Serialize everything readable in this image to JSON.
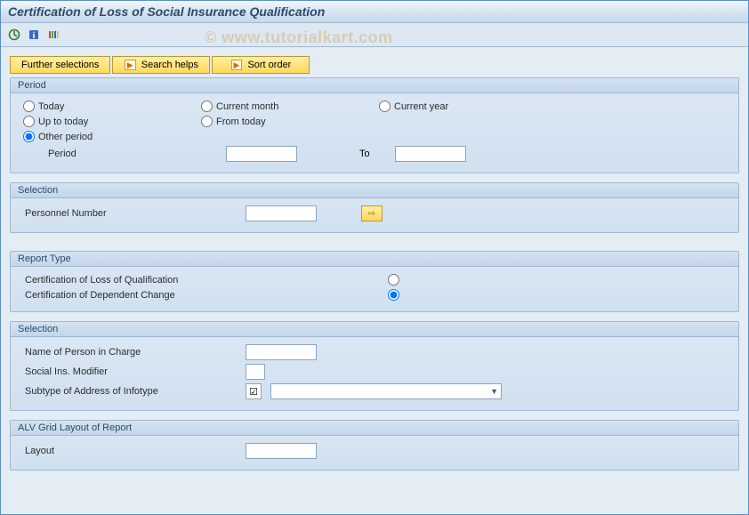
{
  "title": "Certification of Loss of Social Insurance Qualification",
  "watermark": "© www.tutorialkart.com",
  "toolbar": {
    "execute_icon": "⏱",
    "info_icon": "ℹ",
    "variant_icon": "▤"
  },
  "buttons": {
    "further": "Further selections",
    "search": "Search helps",
    "sort": "Sort order"
  },
  "period": {
    "legend": "Period",
    "today": "Today",
    "current_month": "Current month",
    "current_year": "Current year",
    "up_to_today": "Up to today",
    "from_today": "From today",
    "other": "Other period",
    "period_label": "Period",
    "to_label": "To",
    "period_from": "",
    "period_to": ""
  },
  "selection1": {
    "legend": "Selection",
    "personnel_label": "Personnel Number",
    "personnel_value": ""
  },
  "report_type": {
    "legend": "Report Type",
    "loss": "Certification of Loss of Qualification",
    "dependent": "Certification of Dependent Change"
  },
  "selection2": {
    "legend": "Selection",
    "person_in_charge_label": "Name of Person in Charge",
    "person_in_charge_value": "",
    "modifier_label": "Social Ins. Modifier",
    "modifier_value": "",
    "subtype_label": "Subtype of Address of Infotype",
    "subtype_value": "",
    "subtype_checked": "☑"
  },
  "alv": {
    "legend": "ALV Grid Layout of Report",
    "layout_label": "Layout",
    "layout_value": ""
  }
}
